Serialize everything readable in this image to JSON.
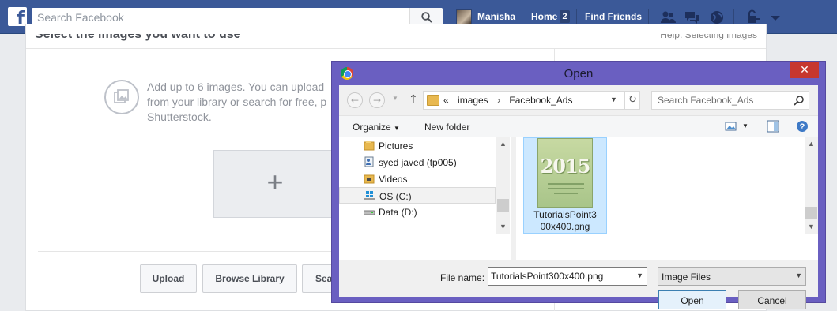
{
  "facebook": {
    "logo": "f",
    "search_placeholder": "Search Facebook",
    "user_name": "Manisha",
    "nav_home": "Home",
    "home_count": "2",
    "nav_find_friends": "Find Friends",
    "brand_color": "#3b5998"
  },
  "page": {
    "title": "Select the images you want to use",
    "help_link": "Help: Selecting images",
    "info_text": "Add up to 6 images. You can upload from your library or search for free, p Shutterstock.",
    "add_image_symbol": "+",
    "buttons": {
      "upload": "Upload",
      "browse_library": "Browse Library",
      "search": "Sea"
    }
  },
  "dialog": {
    "title": "Open",
    "close_symbol": "✕",
    "accent_color": "#6a5fc1",
    "breadcrumb": {
      "overflow": "«",
      "items": [
        "images",
        "Facebook_Ads"
      ]
    },
    "search_placeholder": "Search Facebook_Ads",
    "toolbar": {
      "organize": "Organize",
      "new_folder": "New folder"
    },
    "nav_tree": [
      {
        "label": "Pictures",
        "icon": "pictures-folder-icon"
      },
      {
        "label": "syed javed (tp005)",
        "icon": "user-folder-icon"
      },
      {
        "label": "Videos",
        "icon": "videos-folder-icon"
      },
      {
        "label": "OS (C:)",
        "icon": "windows-drive-icon",
        "selected": true
      },
      {
        "label": "Data (D:)",
        "icon": "drive-icon"
      }
    ],
    "files": [
      {
        "name": "TutorialsPoint300x400.png",
        "thumbnail_text": "2015",
        "selected": true
      }
    ],
    "file_name_label": "File name:",
    "file_name_value": "TutorialsPoint300x400.png",
    "file_type": "Image Files",
    "open_button": "Open",
    "cancel_button": "Cancel"
  }
}
